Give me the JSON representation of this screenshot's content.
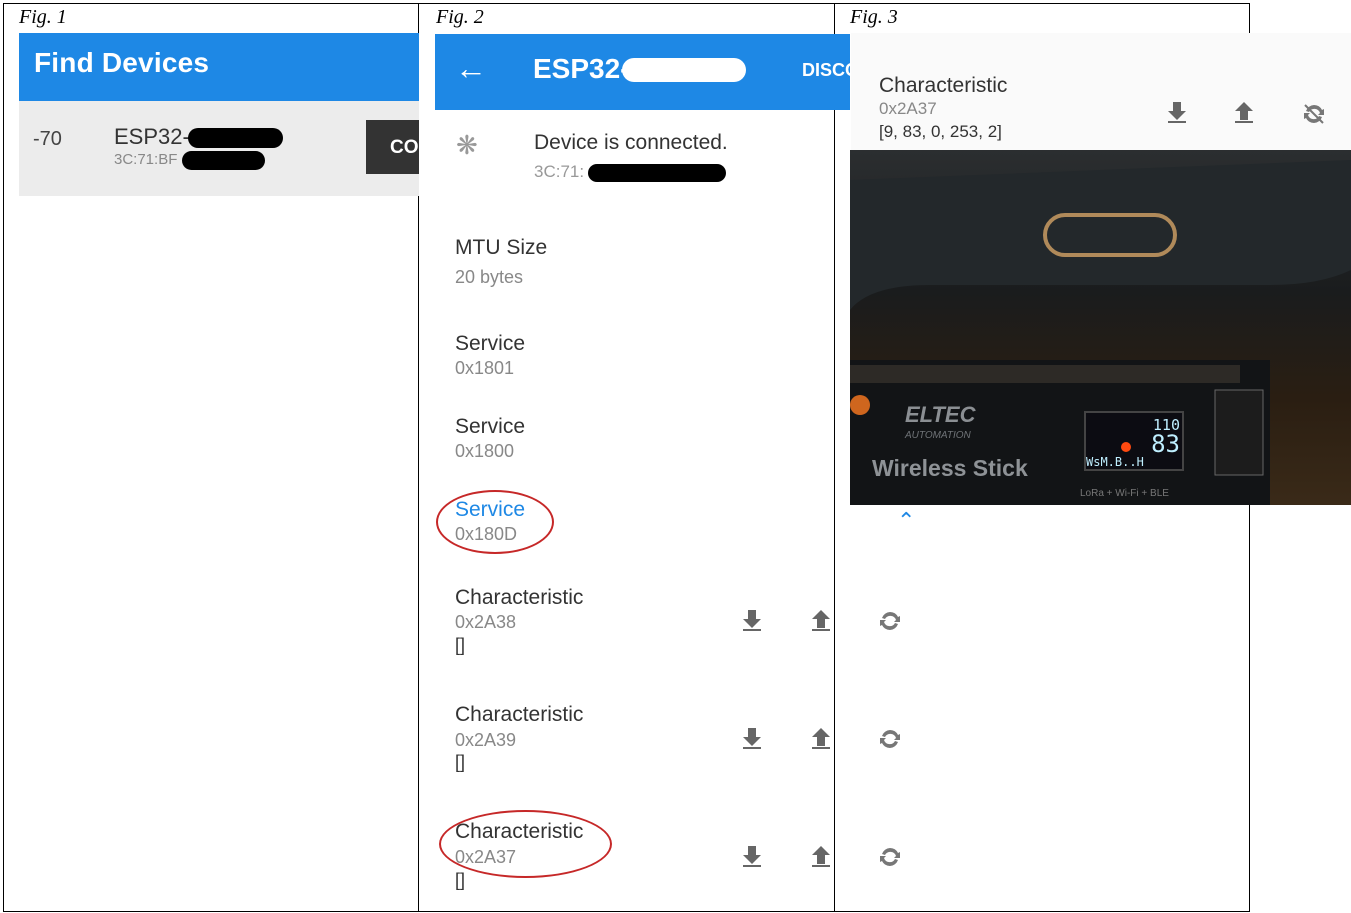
{
  "figures": [
    {
      "label": "Fig. 1"
    },
    {
      "label": "Fig. 2"
    },
    {
      "label": "Fig. 3"
    }
  ],
  "fig1": {
    "title": "Find Devices",
    "device": {
      "rssi": "-70",
      "name_prefix": "ESP32-",
      "address_prefix": "3C:71:BF",
      "button_label": "CONNECT"
    }
  },
  "fig2": {
    "header": {
      "back_icon": "arrow-left-icon",
      "title_prefix": "ESP32-",
      "action_label": "DISCONNECT"
    },
    "status": {
      "icon": "bluetooth-icon",
      "text": "Device is connected.",
      "address_prefix": "3C:71:"
    },
    "mtu": {
      "label": "MTU Size",
      "value": "20 bytes"
    },
    "services": [
      {
        "label": "Service",
        "uuid": "0x1801"
      },
      {
        "label": "Service",
        "uuid": "0x1800"
      },
      {
        "label": "Service",
        "uuid": "0x180D"
      }
    ],
    "characteristics": [
      {
        "label": "Characteristic",
        "uuid": "0x2A38",
        "value": "[]"
      },
      {
        "label": "Characteristic",
        "uuid": "0x2A39",
        "value": "[]"
      },
      {
        "label": "Characteristic",
        "uuid": "0x2A37",
        "value": "[]"
      }
    ],
    "icons": [
      "download-icon",
      "upload-icon",
      "sync-icon"
    ],
    "accent_color": "#1e88e5",
    "highlight_color": "#c62828"
  },
  "fig3": {
    "characteristic": {
      "label": "Characteristic",
      "uuid": "0x2A37",
      "value": "[9, 83, 0, 253, 2]"
    },
    "photo": {
      "brand": "ELTEC",
      "brand_sub": "AUTOMATION",
      "product": "Wireless Stick",
      "badge": "LoRa + Wi-Fi + BLE",
      "screen_line1": "110",
      "screen_line2": "83",
      "screen_line3": "WsM.B..H"
    },
    "collapse_icon": "chevron-up-icon"
  },
  "colors": {
    "app_bar": "#1e88e5",
    "button_dark": "#333333"
  }
}
